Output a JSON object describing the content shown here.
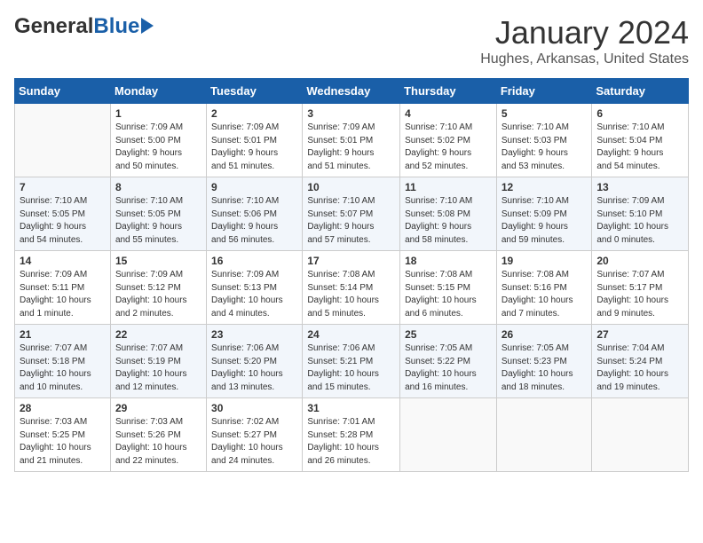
{
  "header": {
    "logo_general": "General",
    "logo_blue": "Blue",
    "title": "January 2024",
    "subtitle": "Hughes, Arkansas, United States"
  },
  "days_of_week": [
    "Sunday",
    "Monday",
    "Tuesday",
    "Wednesday",
    "Thursday",
    "Friday",
    "Saturday"
  ],
  "weeks": [
    [
      {
        "day": "",
        "info": ""
      },
      {
        "day": "1",
        "info": "Sunrise: 7:09 AM\nSunset: 5:00 PM\nDaylight: 9 hours\nand 50 minutes."
      },
      {
        "day": "2",
        "info": "Sunrise: 7:09 AM\nSunset: 5:01 PM\nDaylight: 9 hours\nand 51 minutes."
      },
      {
        "day": "3",
        "info": "Sunrise: 7:09 AM\nSunset: 5:01 PM\nDaylight: 9 hours\nand 51 minutes."
      },
      {
        "day": "4",
        "info": "Sunrise: 7:10 AM\nSunset: 5:02 PM\nDaylight: 9 hours\nand 52 minutes."
      },
      {
        "day": "5",
        "info": "Sunrise: 7:10 AM\nSunset: 5:03 PM\nDaylight: 9 hours\nand 53 minutes."
      },
      {
        "day": "6",
        "info": "Sunrise: 7:10 AM\nSunset: 5:04 PM\nDaylight: 9 hours\nand 54 minutes."
      }
    ],
    [
      {
        "day": "7",
        "info": "Sunrise: 7:10 AM\nSunset: 5:05 PM\nDaylight: 9 hours\nand 54 minutes."
      },
      {
        "day": "8",
        "info": "Sunrise: 7:10 AM\nSunset: 5:05 PM\nDaylight: 9 hours\nand 55 minutes."
      },
      {
        "day": "9",
        "info": "Sunrise: 7:10 AM\nSunset: 5:06 PM\nDaylight: 9 hours\nand 56 minutes."
      },
      {
        "day": "10",
        "info": "Sunrise: 7:10 AM\nSunset: 5:07 PM\nDaylight: 9 hours\nand 57 minutes."
      },
      {
        "day": "11",
        "info": "Sunrise: 7:10 AM\nSunset: 5:08 PM\nDaylight: 9 hours\nand 58 minutes."
      },
      {
        "day": "12",
        "info": "Sunrise: 7:10 AM\nSunset: 5:09 PM\nDaylight: 9 hours\nand 59 minutes."
      },
      {
        "day": "13",
        "info": "Sunrise: 7:09 AM\nSunset: 5:10 PM\nDaylight: 10 hours\nand 0 minutes."
      }
    ],
    [
      {
        "day": "14",
        "info": "Sunrise: 7:09 AM\nSunset: 5:11 PM\nDaylight: 10 hours\nand 1 minute."
      },
      {
        "day": "15",
        "info": "Sunrise: 7:09 AM\nSunset: 5:12 PM\nDaylight: 10 hours\nand 2 minutes."
      },
      {
        "day": "16",
        "info": "Sunrise: 7:09 AM\nSunset: 5:13 PM\nDaylight: 10 hours\nand 4 minutes."
      },
      {
        "day": "17",
        "info": "Sunrise: 7:08 AM\nSunset: 5:14 PM\nDaylight: 10 hours\nand 5 minutes."
      },
      {
        "day": "18",
        "info": "Sunrise: 7:08 AM\nSunset: 5:15 PM\nDaylight: 10 hours\nand 6 minutes."
      },
      {
        "day": "19",
        "info": "Sunrise: 7:08 AM\nSunset: 5:16 PM\nDaylight: 10 hours\nand 7 minutes."
      },
      {
        "day": "20",
        "info": "Sunrise: 7:07 AM\nSunset: 5:17 PM\nDaylight: 10 hours\nand 9 minutes."
      }
    ],
    [
      {
        "day": "21",
        "info": "Sunrise: 7:07 AM\nSunset: 5:18 PM\nDaylight: 10 hours\nand 10 minutes."
      },
      {
        "day": "22",
        "info": "Sunrise: 7:07 AM\nSunset: 5:19 PM\nDaylight: 10 hours\nand 12 minutes."
      },
      {
        "day": "23",
        "info": "Sunrise: 7:06 AM\nSunset: 5:20 PM\nDaylight: 10 hours\nand 13 minutes."
      },
      {
        "day": "24",
        "info": "Sunrise: 7:06 AM\nSunset: 5:21 PM\nDaylight: 10 hours\nand 15 minutes."
      },
      {
        "day": "25",
        "info": "Sunrise: 7:05 AM\nSunset: 5:22 PM\nDaylight: 10 hours\nand 16 minutes."
      },
      {
        "day": "26",
        "info": "Sunrise: 7:05 AM\nSunset: 5:23 PM\nDaylight: 10 hours\nand 18 minutes."
      },
      {
        "day": "27",
        "info": "Sunrise: 7:04 AM\nSunset: 5:24 PM\nDaylight: 10 hours\nand 19 minutes."
      }
    ],
    [
      {
        "day": "28",
        "info": "Sunrise: 7:03 AM\nSunset: 5:25 PM\nDaylight: 10 hours\nand 21 minutes."
      },
      {
        "day": "29",
        "info": "Sunrise: 7:03 AM\nSunset: 5:26 PM\nDaylight: 10 hours\nand 22 minutes."
      },
      {
        "day": "30",
        "info": "Sunrise: 7:02 AM\nSunset: 5:27 PM\nDaylight: 10 hours\nand 24 minutes."
      },
      {
        "day": "31",
        "info": "Sunrise: 7:01 AM\nSunset: 5:28 PM\nDaylight: 10 hours\nand 26 minutes."
      },
      {
        "day": "",
        "info": ""
      },
      {
        "day": "",
        "info": ""
      },
      {
        "day": "",
        "info": ""
      }
    ]
  ]
}
